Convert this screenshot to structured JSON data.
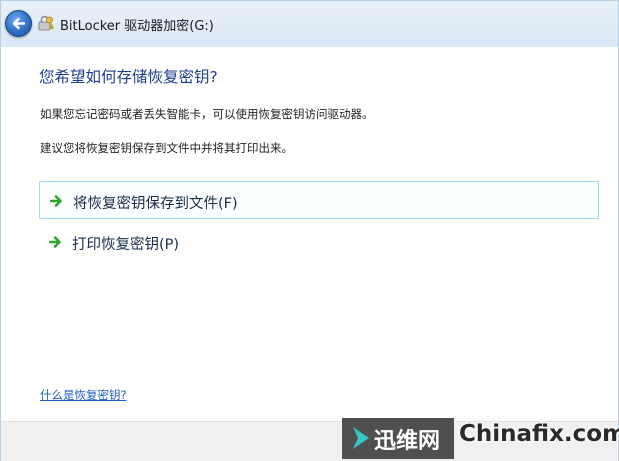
{
  "window": {
    "title": "BitLocker 驱动器加密(G:)",
    "back_icon": "back-arrow-icon",
    "app_icon": "bitlocker-key-icon"
  },
  "main": {
    "heading": "您希望如何存储恢复密钥?",
    "desc1": "如果您忘记密码或者丢失智能卡，可以使用恢复密钥访问驱动器。",
    "desc2": "建议您将恢复密钥保存到文件中并将其打印出来。",
    "options": [
      {
        "label": "将恢复密钥保存到文件(F)",
        "icon": "green-arrow-icon",
        "hovered": true
      },
      {
        "label": "打印恢复密钥(P)",
        "icon": "green-arrow-icon",
        "hovered": false
      }
    ],
    "help_link": "什么是恢复密钥?"
  },
  "watermark": {
    "cn": "迅维网",
    "en": "Chinafix.com"
  },
  "colors": {
    "heading": "#1b3f8f",
    "link": "#1f5ec8",
    "arrow": "#2fa52f",
    "hover_border": "#9fd8ee"
  }
}
